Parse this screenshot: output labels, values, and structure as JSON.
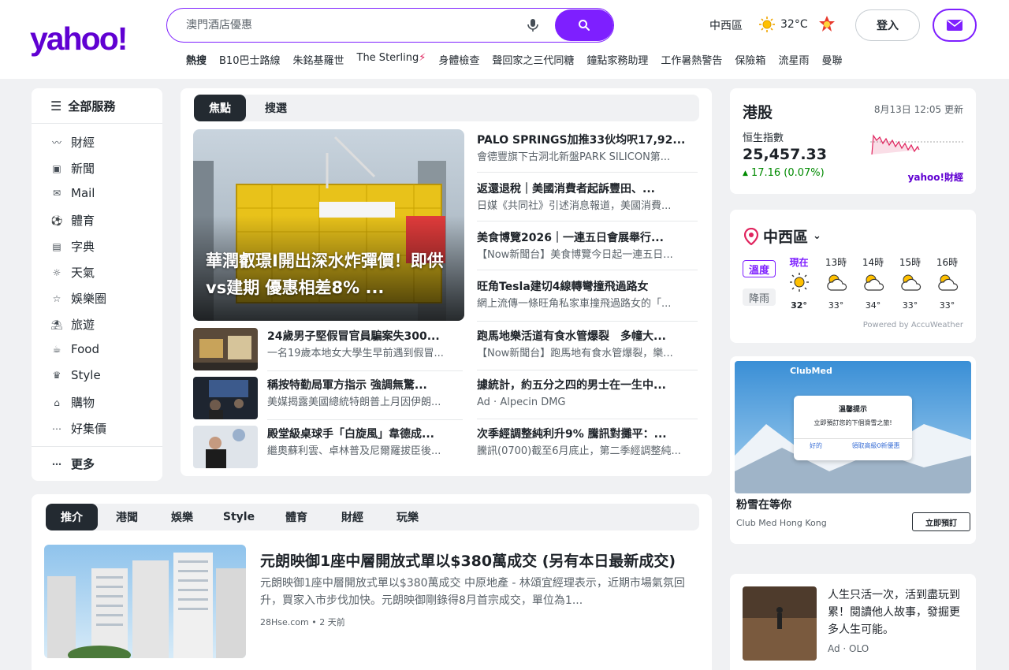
{
  "header": {
    "logo": "yahoo!",
    "search_placeholder": "澳門酒店優惠",
    "trending_label": "熱搜",
    "trending": [
      "B10巴士路線",
      "朱銘基羅世",
      "The Sterling",
      "身體檢查",
      "聲回家之三代同糖",
      "鐘點家務助理",
      "工作暑熱警告",
      "保險箱",
      "流星雨",
      "曼聯"
    ],
    "location": "中西區",
    "temperature": "32°C",
    "login": "登入"
  },
  "leftnav": {
    "all_services": "全部服務",
    "items": [
      {
        "label": "財經",
        "icon": "chart-icon"
      },
      {
        "label": "新聞",
        "icon": "news-icon"
      },
      {
        "label": "Mail",
        "icon": "mail-icon"
      },
      {
        "label": "體育",
        "icon": "sports-icon"
      },
      {
        "label": "字典",
        "icon": "dictionary-icon"
      },
      {
        "label": "天氣",
        "icon": "weather-icon"
      },
      {
        "label": "娛樂圈",
        "icon": "star-icon"
      },
      {
        "label": "旅遊",
        "icon": "travel-icon"
      },
      {
        "label": "Food",
        "icon": "food-icon"
      },
      {
        "label": "Style",
        "icon": "style-icon"
      },
      {
        "label": "購物",
        "icon": "shopping-icon"
      },
      {
        "label": "好集價",
        "icon": "deals-icon"
      }
    ],
    "more": "更多"
  },
  "topnews": {
    "tabs": [
      "焦點",
      "搜選"
    ],
    "hero_title": "華潤叡璟I開出深水炸彈價！即供vs建期 優惠相差8% ...",
    "right_stories": [
      {
        "title": "PALO SPRINGS加推33伙均呎17,92...",
        "summary": "會德豐旗下古洞北新盤PARK SILICON第..."
      },
      {
        "title": "返還退稅｜美國消費者起訴豐田、...",
        "summary": "日媒《共同社》引述消息報道，美國消費..."
      },
      {
        "title": "美食博覽2026｜一連五日會展舉行...",
        "summary": "【Now新聞台】美食博覽今日起一連五日..."
      },
      {
        "title": "旺角Tesla建切4線轉彎撞飛過路女",
        "summary": "網上流傳一條旺角私家車撞飛過路女的「..."
      },
      {
        "title": "跑馬地樂活道有食水管爆裂　多幢大...",
        "summary": "【Now新聞台】跑馬地有食水管爆裂，樂..."
      },
      {
        "title": "據統計，約五分之四的男士在一生中...",
        "summary": "Ad · Alpecin DMG"
      },
      {
        "title": "次季經調整純利升9% 騰訊對攤平：...",
        "summary": "騰訊(0700)截至6月底止，第二季經調整純..."
      }
    ],
    "left_stories": [
      {
        "title": "24歲男子堅假冒官員騙案失300...",
        "summary": "一名19歲本地女大學生早前遇到假冒..."
      },
      {
        "title": "稱按特勤局軍方指示 強調無驚...",
        "summary": "美媒揭露美國總統特朗普上月因伊朗..."
      },
      {
        "title": "殿堂級桌球手「白旋風」韋德成...",
        "summary": "繼奧蘇利雲、卓林普及尼爾羅拔臣後..."
      }
    ]
  },
  "stock": {
    "title": "港股",
    "updated": "8月13日 12:05 更新",
    "index_name": "恒生指數",
    "value": "25,457.33",
    "change": "17.16 (0.07%)",
    "brand": "yahoo!財經"
  },
  "weather": {
    "location": "中西區",
    "toggle_temp": "溫度",
    "toggle_rain": "降雨",
    "hours": [
      {
        "time": "現在",
        "temp": "32°"
      },
      {
        "time": "13時",
        "temp": "33°"
      },
      {
        "time": "14時",
        "temp": "34°"
      },
      {
        "time": "15時",
        "temp": "33°"
      },
      {
        "time": "16時",
        "temp": "33°"
      }
    ],
    "powered": "Powered by AccuWeather"
  },
  "ad": {
    "brand_top": "ClubMed",
    "popup_title": "溫馨提示",
    "popup_text": "立即預訂您的下個滑雪之旅!",
    "popup_btn1": "好的",
    "popup_btn2": "領取高級0新優惠",
    "title": "粉雪在等你",
    "sponsor": "Club Med Hong Kong",
    "cta": "立即預訂"
  },
  "ad2": {
    "text": "人生只活一次，活到盡玩到累！閱讀他人故事，發掘更多人生可能。",
    "sponsor": "Ad · OLO"
  },
  "feed": {
    "tabs": [
      "推介",
      "港聞",
      "娛樂",
      "Style",
      "體育",
      "財經",
      "玩樂"
    ],
    "story_title": "元朗映御1座中層開放式單以$380萬成交 (另有本日最新成交)",
    "story_summary": "元朗映御1座中層開放式單以$380萬成交 中原地產 - 林頌宜經理表示，近期市場氣氛回升，買家入市步伐加快。元朗映御剛錄得8月首宗成交，單位為1...",
    "story_meta": "28Hse.com • 2 天前"
  },
  "colors": {
    "brand": "#6001d2",
    "accent": "#7e1fff",
    "up": "#008a00"
  }
}
